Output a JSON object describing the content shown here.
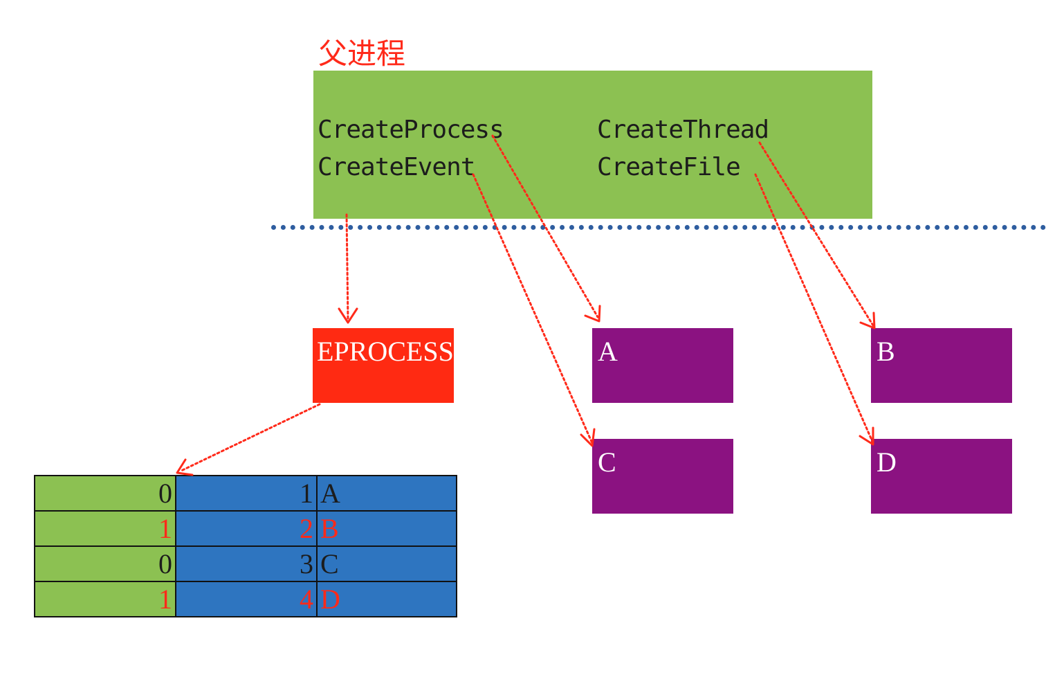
{
  "title": "父进程",
  "parent": {
    "functions": [
      {
        "key": "create_process",
        "label": "CreateProcess"
      },
      {
        "key": "create_thread",
        "label": "CreateThread"
      },
      {
        "key": "create_event",
        "label": "CreateEvent"
      },
      {
        "key": "create_file",
        "label": "CreateFile"
      }
    ]
  },
  "eprocess": {
    "label": "EPROCESS"
  },
  "objects": {
    "a": {
      "label": "A"
    },
    "b": {
      "label": "B"
    },
    "c": {
      "label": "C"
    },
    "d": {
      "label": "D"
    }
  },
  "handle_table": {
    "rows": [
      {
        "flag": "0",
        "index": "1",
        "object": "A",
        "highlight": false
      },
      {
        "flag": "1",
        "index": "2",
        "object": "B",
        "highlight": true
      },
      {
        "flag": "0",
        "index": "3",
        "object": "C",
        "highlight": false
      },
      {
        "flag": "1",
        "index": "4",
        "object": "D",
        "highlight": true
      }
    ]
  },
  "colors": {
    "parent_box": "#8cc152",
    "eprocess_box": "#ff2a12",
    "kernel_object": "#8b1281",
    "table_flag": "#8cc152",
    "table_body": "#2e75c0",
    "separator": "#2e5d9f",
    "arrow": "#ff2a1a",
    "title": "#ff2a1a"
  }
}
